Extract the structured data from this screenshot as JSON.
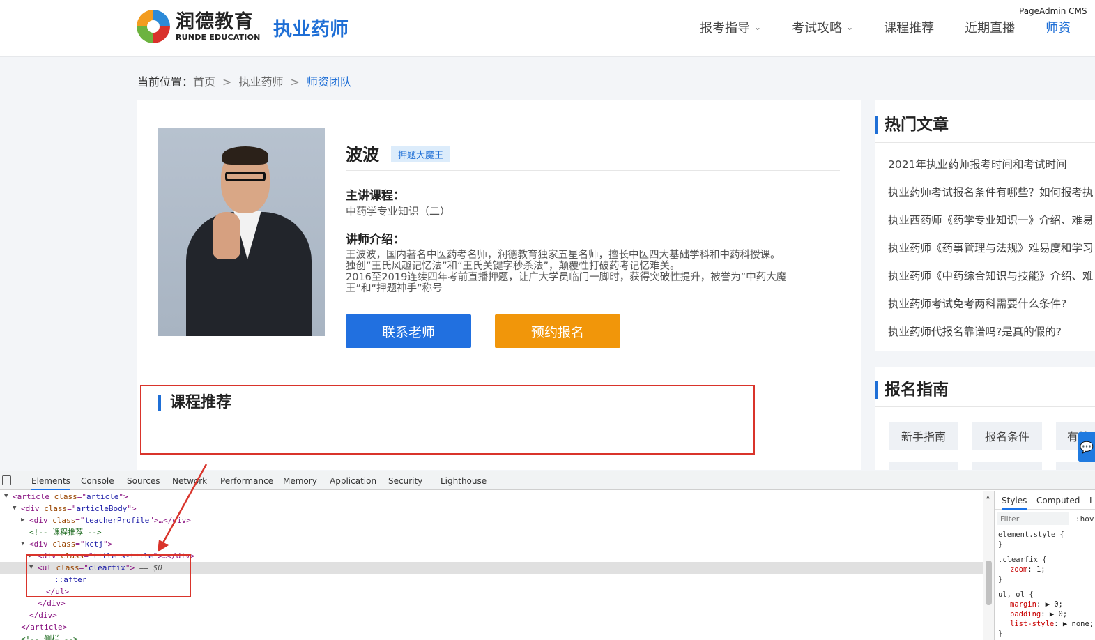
{
  "header": {
    "logo_cn": "润德教育",
    "logo_en": "RUNDE EDUCATION",
    "site_title": "执业药师",
    "cms_tag": "PageAdmin CMS",
    "nav": [
      {
        "label": "报考指导",
        "has_dropdown": true
      },
      {
        "label": "考试攻略",
        "has_dropdown": true
      },
      {
        "label": "课程推荐",
        "has_dropdown": false
      },
      {
        "label": "近期直播",
        "has_dropdown": false
      },
      {
        "label": "师资",
        "has_dropdown": false,
        "active": true
      }
    ],
    "chevron": "⌄"
  },
  "breadcrumb": {
    "label": "当前位置：",
    "items": [
      "首页",
      "执业药师",
      "师资团队"
    ],
    "separator": ">"
  },
  "teacher": {
    "name": "波波",
    "tag": "押题大魔王",
    "course_heading": "主讲课程：",
    "course": "中药学专业知识（二）",
    "intro_heading": "讲师介绍：",
    "intro_lines": [
      "王波波，国内著名中医药考名师，润德教育独家五星名师，擅长中医四大基础学科和中药科授课。",
      "独创“王氏风趣记忆法”和“王氏关键字秒杀法”，颠覆性打破药考记忆难关。",
      "2016至2019连续四年考前直播押题，让广大学员临门一脚时，获得突破性提升，被誉为“中药大魔",
      "王”和“押题神手”称号"
    ],
    "btn_contact": "联系老师",
    "btn_enroll": "预约报名"
  },
  "course_recommend": {
    "title": "课程推荐"
  },
  "sidebar": {
    "hot_title": "热门文章",
    "hot_articles": [
      "2021年执业药师报考时间和考试时间",
      "执业药师考试报名条件有哪些？如何报考执",
      "执业西药师《药学专业知识一》介绍、难易",
      "执业药师《药事管理与法规》难易度和学习",
      "执业药师《中药综合知识与技能》介绍、难",
      "执业药师考试免考两科需要什么条件?",
      "执业药师代报名靠谱吗?是真的假的?"
    ],
    "guide_title": "报名指南",
    "guide_chips": [
      "新手指南",
      "报名条件",
      "有效"
    ]
  },
  "devtools": {
    "tabs": [
      "Elements",
      "Console",
      "Sources",
      "Network",
      "Performance",
      "Memory",
      "Application",
      "Security",
      "Lighthouse"
    ],
    "active_tab": "Elements",
    "styles_tabs": [
      "Styles",
      "Computed",
      "L"
    ],
    "filter_placeholder": "Filter",
    "hov": ":hov",
    "dom_rows": [
      {
        "indent": 1,
        "toggle": "▼",
        "parts": [
          [
            "tg",
            "<article "
          ],
          [
            "an",
            "class"
          ],
          [
            "tg",
            "=\""
          ],
          [
            "av",
            "article"
          ],
          [
            "tg",
            "\">"
          ]
        ]
      },
      {
        "indent": 2,
        "toggle": "▼",
        "parts": [
          [
            "tg",
            "<div "
          ],
          [
            "an",
            "class"
          ],
          [
            "tg",
            "=\""
          ],
          [
            "av",
            "articleBody"
          ],
          [
            "tg",
            "\">"
          ]
        ]
      },
      {
        "indent": 3,
        "toggle": "▶",
        "parts": [
          [
            "tg",
            "<div "
          ],
          [
            "an",
            "class"
          ],
          [
            "tg",
            "=\""
          ],
          [
            "av",
            "teacherProfile"
          ],
          [
            "tg",
            "\">…</div>"
          ]
        ]
      },
      {
        "indent": 3,
        "toggle": "",
        "parts": [
          [
            "cm",
            "<!-- 课程推荐 -->"
          ]
        ]
      },
      {
        "indent": 3,
        "toggle": "▼",
        "parts": [
          [
            "tg",
            "<div "
          ],
          [
            "an",
            "class"
          ],
          [
            "tg",
            "=\""
          ],
          [
            "av",
            "kctj"
          ],
          [
            "tg",
            "\">"
          ]
        ]
      },
      {
        "indent": 4,
        "toggle": "▶",
        "parts": [
          [
            "tg",
            "<div "
          ],
          [
            "an",
            "class"
          ],
          [
            "tg",
            "=\""
          ],
          [
            "av",
            "title s-title"
          ],
          [
            "tg",
            "\">…</div>"
          ]
        ]
      },
      {
        "indent": 4,
        "toggle": "▼",
        "selected": true,
        "parts": [
          [
            "tg",
            "<ul "
          ],
          [
            "an",
            "class"
          ],
          [
            "tg",
            "=\""
          ],
          [
            "av",
            "clearfix"
          ],
          [
            "tg",
            "\">"
          ],
          [
            "eq",
            " == $0"
          ]
        ]
      },
      {
        "indent": 6,
        "toggle": "",
        "parts": [
          [
            "ps",
            "::after"
          ]
        ]
      },
      {
        "indent": 5,
        "toggle": "",
        "parts": [
          [
            "tg",
            "</ul>"
          ]
        ]
      },
      {
        "indent": 4,
        "toggle": "",
        "parts": [
          [
            "tg",
            "</div>"
          ]
        ]
      },
      {
        "indent": 3,
        "toggle": "",
        "parts": [
          [
            "tg",
            "</div>"
          ]
        ]
      },
      {
        "indent": 2,
        "toggle": "",
        "parts": [
          [
            "tg",
            "</article>"
          ]
        ]
      },
      {
        "indent": 2,
        "toggle": "",
        "parts": [
          [
            "cm",
            "<!-- 侧栏 -->"
          ]
        ]
      }
    ],
    "style_rules": [
      {
        "selector": "element.style {",
        "props": [],
        "close": "}"
      },
      {
        "selector": ".clearfix {",
        "props": [
          [
            "zoom",
            "1"
          ]
        ],
        "close": "}"
      },
      {
        "selector": "ul, ol {",
        "props": [
          [
            "margin",
            "▶ 0"
          ],
          [
            "padding",
            "▶ 0"
          ],
          [
            "list-style",
            "▶ none"
          ]
        ],
        "close": "}"
      }
    ]
  }
}
